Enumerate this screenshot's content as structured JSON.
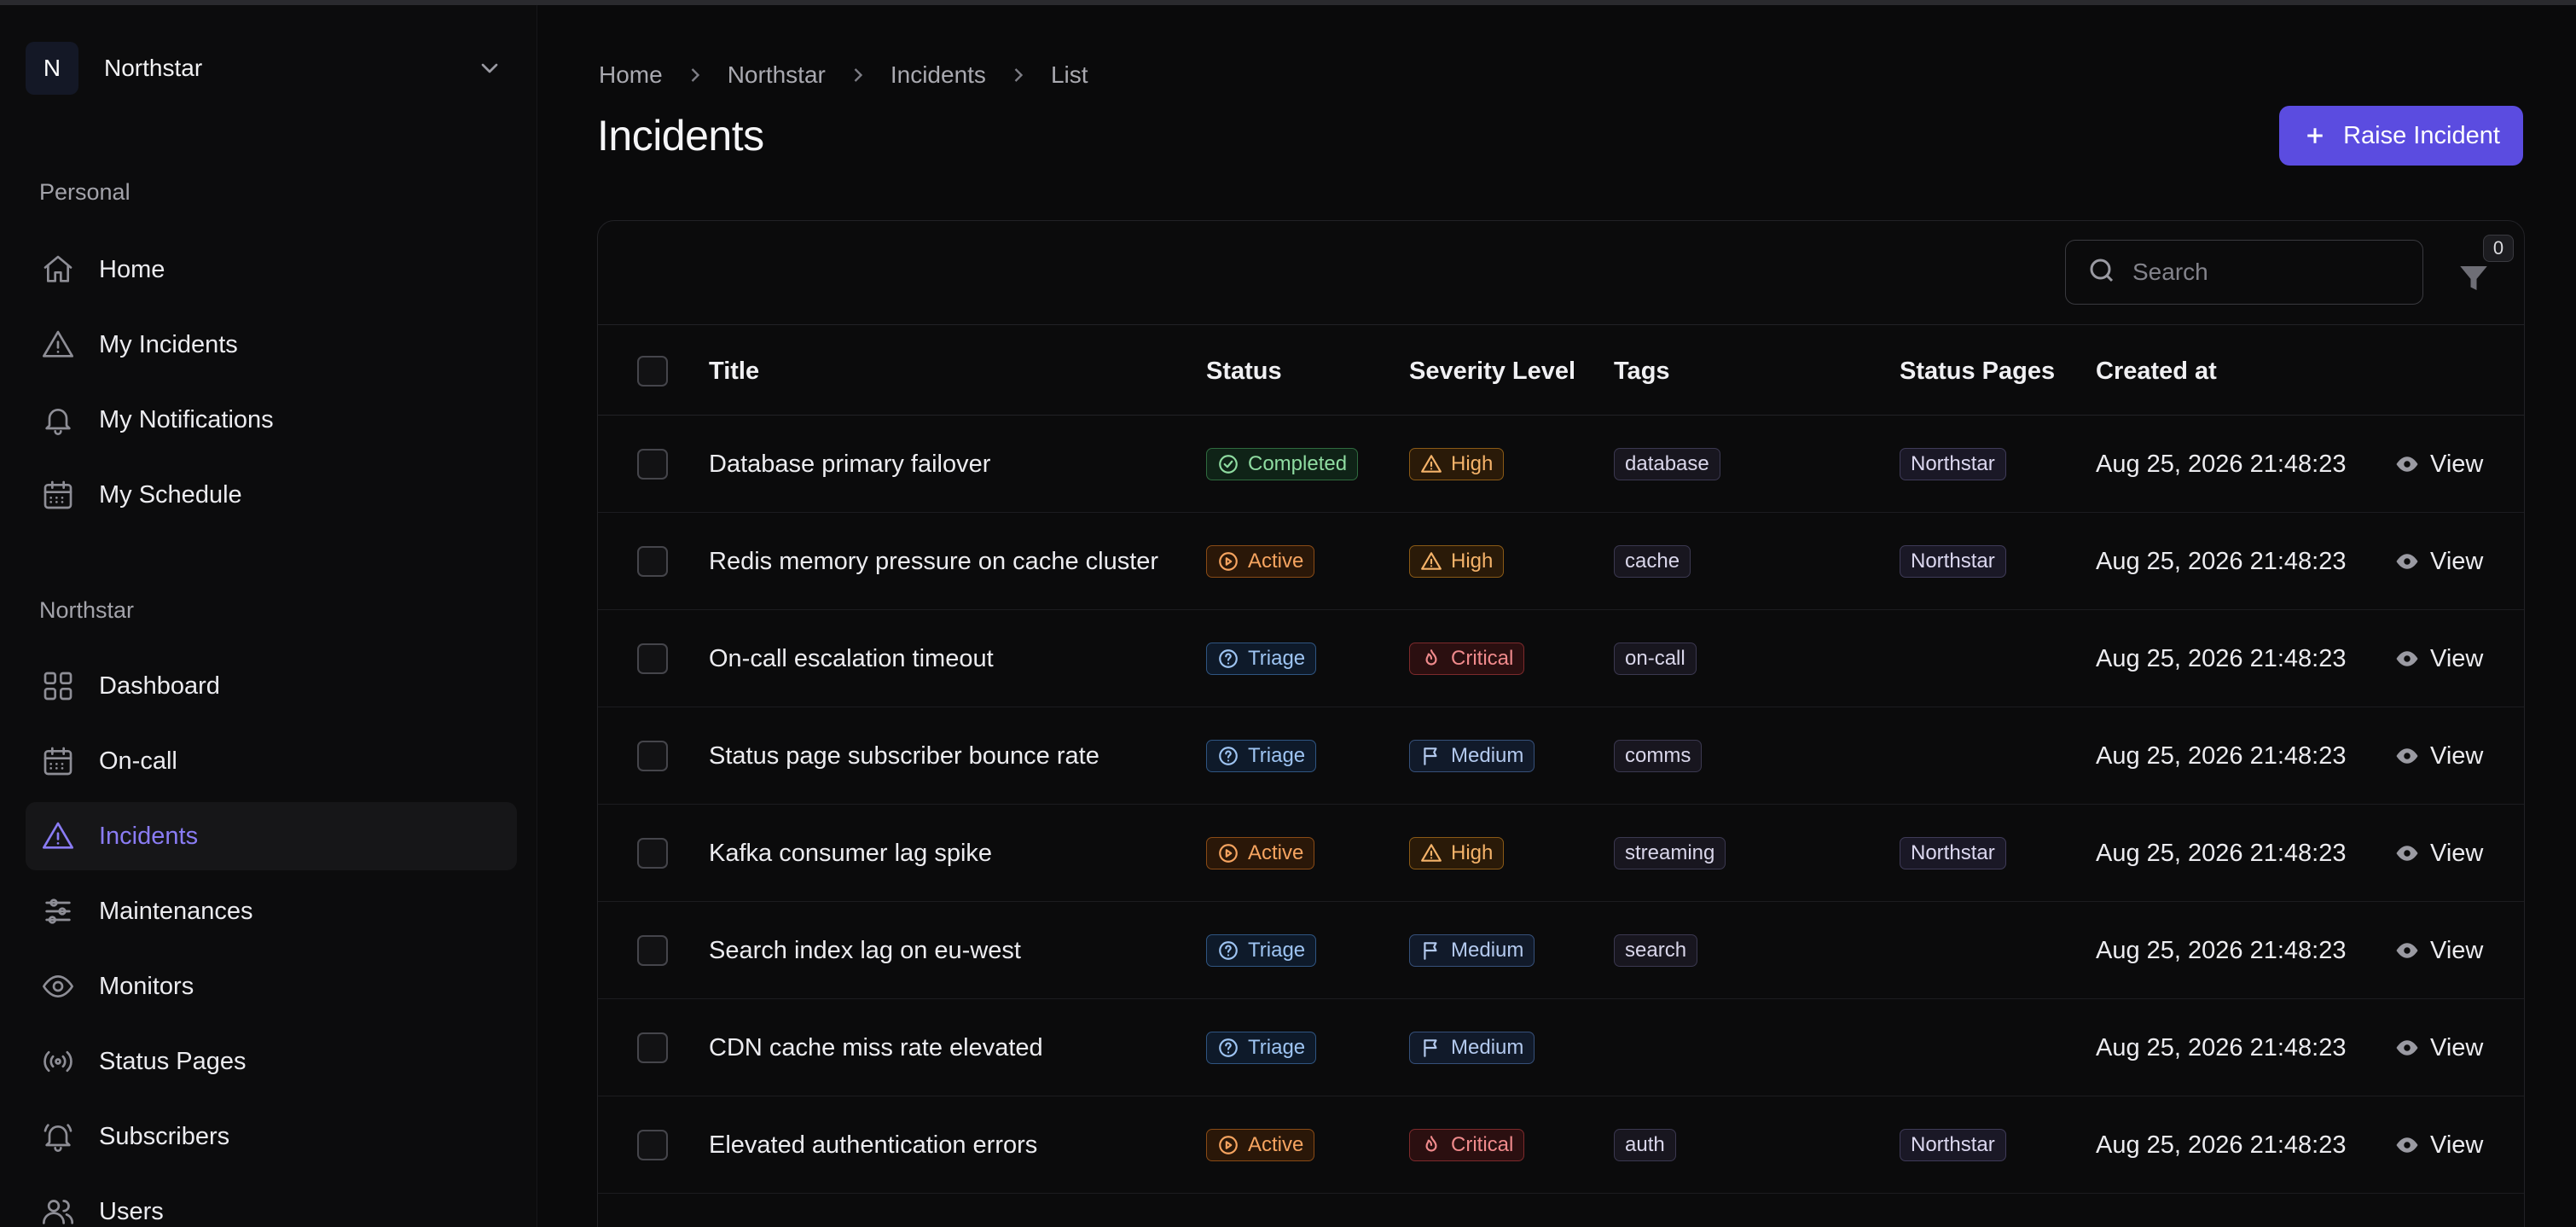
{
  "org": {
    "initial": "N",
    "name": "Northstar"
  },
  "sidebar": {
    "personal_label": "Personal",
    "personal": [
      {
        "label": "Home",
        "icon": "home-icon"
      },
      {
        "label": "My Incidents",
        "icon": "alert-triangle-icon"
      },
      {
        "label": "My Notifications",
        "icon": "bell-icon"
      },
      {
        "label": "My Schedule",
        "icon": "calendar-icon"
      }
    ],
    "org_label": "Northstar",
    "org_items": [
      {
        "label": "Dashboard",
        "icon": "grid-icon"
      },
      {
        "label": "On-call",
        "icon": "calendar-icon"
      },
      {
        "label": "Incidents",
        "icon": "alert-triangle-icon",
        "active": true
      },
      {
        "label": "Maintenances",
        "icon": "sliders-icon"
      },
      {
        "label": "Monitors",
        "icon": "eye-icon"
      },
      {
        "label": "Status Pages",
        "icon": "broadcast-icon"
      },
      {
        "label": "Subscribers",
        "icon": "bell-ring-icon"
      },
      {
        "label": "Users",
        "icon": "users-icon"
      }
    ]
  },
  "breadcrumb": [
    "Home",
    "Northstar",
    "Incidents",
    "List"
  ],
  "page": {
    "title": "Incidents",
    "raise_label": "Raise Incident"
  },
  "toolbar": {
    "search_placeholder": "Search",
    "filter_count": "0"
  },
  "table": {
    "headers": {
      "title": "Title",
      "status": "Status",
      "severity": "Severity Level",
      "tags": "Tags",
      "status_pages": "Status Pages",
      "created": "Created at"
    },
    "view_label": "View",
    "rows": [
      {
        "title": "Database primary failover",
        "status": "Completed",
        "severity": "High",
        "tag": "database",
        "page": "Northstar",
        "created": "Aug 25, 2026 21:48:23"
      },
      {
        "title": "Redis memory pressure on cache cluster",
        "status": "Active",
        "severity": "High",
        "tag": "cache",
        "page": "Northstar",
        "created": "Aug 25, 2026 21:48:23"
      },
      {
        "title": "On-call escalation timeout",
        "status": "Triage",
        "severity": "Critical",
        "tag": "on-call",
        "page": "",
        "created": "Aug 25, 2026 21:48:23"
      },
      {
        "title": "Status page subscriber bounce rate",
        "status": "Triage",
        "severity": "Medium",
        "tag": "comms",
        "page": "",
        "created": "Aug 25, 2026 21:48:23"
      },
      {
        "title": "Kafka consumer lag spike",
        "status": "Active",
        "severity": "High",
        "tag": "streaming",
        "page": "Northstar",
        "created": "Aug 25, 2026 21:48:23"
      },
      {
        "title": "Search index lag on eu-west",
        "status": "Triage",
        "severity": "Medium",
        "tag": "search",
        "page": "",
        "created": "Aug 25, 2026 21:48:23"
      },
      {
        "title": "CDN cache miss rate elevated",
        "status": "Triage",
        "severity": "Medium",
        "tag": "",
        "page": "",
        "created": "Aug 25, 2026 21:48:23"
      },
      {
        "title": "Elevated authentication errors",
        "status": "Active",
        "severity": "Critical",
        "tag": "auth",
        "page": "Northstar",
        "created": "Aug 25, 2026 21:48:23"
      }
    ]
  }
}
